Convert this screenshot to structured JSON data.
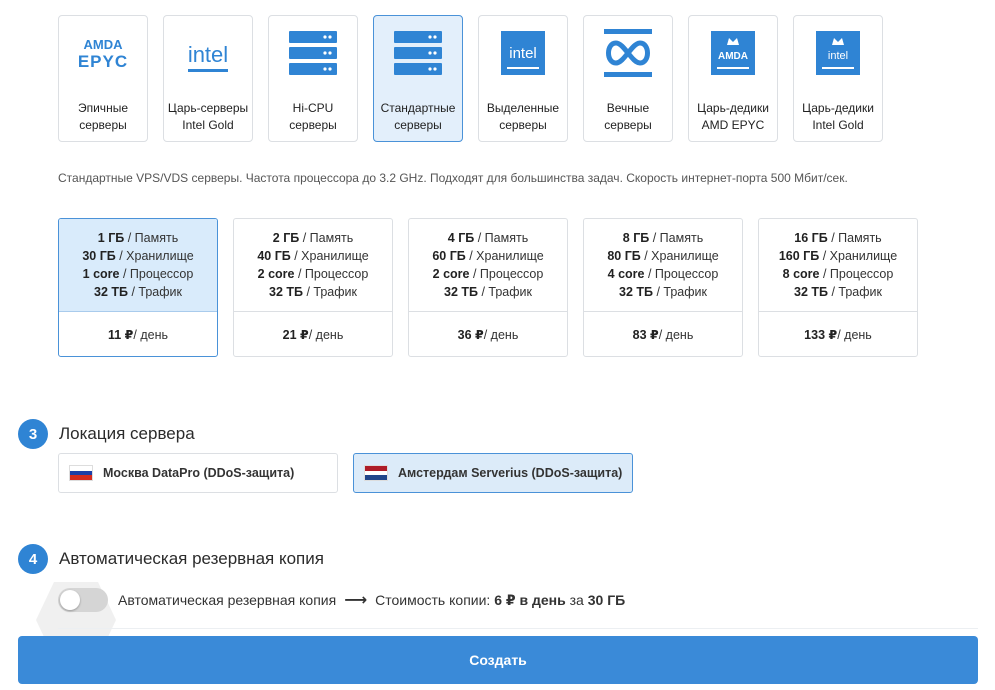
{
  "server_types": [
    {
      "line1": "Эпичные",
      "line2": "серверы",
      "icon": "amd-epyc-icon",
      "active": false
    },
    {
      "line1": "Царь-серверы",
      "line2": "Intel Gold",
      "icon": "intel-icon",
      "active": false
    },
    {
      "line1": "Hi-CPU",
      "line2": "серверы",
      "icon": "server-rack-icon",
      "active": false
    },
    {
      "line1": "Стандартные",
      "line2": "серверы",
      "icon": "server-rack-icon",
      "active": true
    },
    {
      "line1": "Выделенные",
      "line2": "серверы",
      "icon": "intel-chip-icon",
      "active": false
    },
    {
      "line1": "Вечные",
      "line2": "серверы",
      "icon": "infinity-server-icon",
      "active": false
    },
    {
      "line1": "Царь-дедики",
      "line2": "AMD EPYC",
      "icon": "amd-crown-chip-icon",
      "active": false
    },
    {
      "line1": "Царь-дедики",
      "line2": "Intel Gold",
      "icon": "intel-crown-chip-icon",
      "active": false
    }
  ],
  "icon_text": {
    "amd": "AMDA",
    "epyc": "EPYC",
    "intel": "intel",
    "amd_small": "AMDA",
    "intel_small": "intel"
  },
  "description": "Стандартные VPS/VDS серверы. Частота процессора до 3.2 GHz. Подходят для большинства задач. Скорость интернет-порта 500 Мбит/сек.",
  "plans": [
    {
      "mem": "1 ГБ",
      "storage": "30 ГБ",
      "cpu": "1 core",
      "traffic": "32 ТБ",
      "price": "11 ₽",
      "active": true
    },
    {
      "mem": "2 ГБ",
      "storage": "40 ГБ",
      "cpu": "2 core",
      "traffic": "32 ТБ",
      "price": "21 ₽",
      "active": false
    },
    {
      "mem": "4 ГБ",
      "storage": "60 ГБ",
      "cpu": "2 core",
      "traffic": "32 ТБ",
      "price": "36 ₽",
      "active": false
    },
    {
      "mem": "8 ГБ",
      "storage": "80 ГБ",
      "cpu": "4 core",
      "traffic": "32 ТБ",
      "price": "83 ₽",
      "active": false
    },
    {
      "mem": "16 ГБ",
      "storage": "160 ГБ",
      "cpu": "8 core",
      "traffic": "32 ТБ",
      "price": "133 ₽",
      "active": false
    }
  ],
  "plan_labels": {
    "mem": " / Память",
    "storage": " / Хранилище",
    "cpu": " / Процессор",
    "traffic": " / Трафик",
    "per_day": " / день"
  },
  "steps": {
    "location": {
      "num": "3",
      "title": "Локация сервера"
    },
    "backup": {
      "num": "4",
      "title": "Автоматическая резервная копия"
    }
  },
  "locations": [
    {
      "name": "Москва DataPro (DDoS-защита)",
      "flag": [
        "#ffffff",
        "#1c3fa8",
        "#d52b1e"
      ],
      "active": false
    },
    {
      "name": "Амстердам Serverius (DDoS-защита)",
      "flag": [
        "#ae1c28",
        "#ffffff",
        "#21468b"
      ],
      "active": true
    }
  ],
  "backup": {
    "label": "Автоматическая резервная копия",
    "cost_prefix": "Стоимость копии: ",
    "cost_value": "6 ₽",
    "cost_mid": " в день",
    "cost_suffix": " за ",
    "cost_size": "30 ГБ",
    "enabled": false
  },
  "create_button": "Создать",
  "colors": {
    "accent": "#2f84d4",
    "active_bg": "#d9ebfb",
    "button": "#3a8ad8"
  }
}
